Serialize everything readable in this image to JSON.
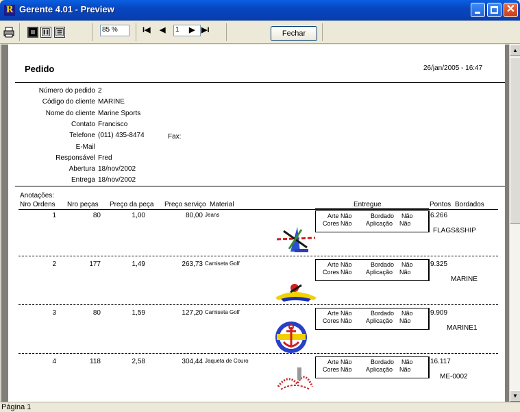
{
  "window": {
    "title": "Gerente 4.01 - Preview",
    "app_icon_letter": "R"
  },
  "toolbar": {
    "zoom": "85 %",
    "page_input": "1",
    "close_label": "Fechar",
    "nav_first": "I◀",
    "nav_prev": "◀",
    "nav_next": "▶",
    "nav_last": "▶I"
  },
  "report": {
    "title": "Pedido",
    "date": "26/jan/2005 - 16:47",
    "fields": [
      {
        "label": "Número do pedido",
        "value": "2"
      },
      {
        "label": "Código do cliente",
        "value": "MARINE"
      },
      {
        "label": "Nome do cliente",
        "value": "Marine Sports"
      },
      {
        "label": "Contato",
        "value": "Francisco"
      },
      {
        "label": "Telefone",
        "value": "(011) 435-8474"
      },
      {
        "label": "E-Mail",
        "value": ""
      },
      {
        "label": "Responsável",
        "value": "Fred"
      },
      {
        "label": "Abertura",
        "value": "18/nov/2002"
      },
      {
        "label": "Entrega",
        "value": "18/nov/2002"
      }
    ],
    "fax_label": "Fax:",
    "annotations_label": "Anotações:",
    "columns": {
      "nro": "Nro Ordens",
      "pecas": "Nro peças",
      "preco_peca": "Preço da peça",
      "preco_servico": "Preço serviço",
      "material": "Material",
      "entregue": "Entregue",
      "pontos": "Pontos",
      "bordados": "Bordados"
    },
    "entregue_labels": {
      "arte": "Arte",
      "cores": "Cores",
      "bordado": "Bordado",
      "aplicacao": "Aplicação",
      "nao": "Não"
    },
    "rows": [
      {
        "nro": "1",
        "pecas": "80",
        "preco_peca": "1,00",
        "preco_servico": "80,00",
        "material": "Jeans",
        "pontos": "6.266",
        "bordado": "FLAGS&SHIP",
        "logo": "flags-ship-logo"
      },
      {
        "nro": "2",
        "pecas": "177",
        "preco_peca": "1,49",
        "preco_servico": "263,73",
        "material": "Camiseta Golf",
        "pontos": "9.325",
        "bordado": "MARINE",
        "logo": "marine-logo"
      },
      {
        "nro": "3",
        "pecas": "80",
        "preco_peca": "1,59",
        "preco_servico": "127,20",
        "material": "Camiseta Golf",
        "pontos": "9.909",
        "bordado": "MARINE1",
        "logo": "anchor-logo"
      },
      {
        "nro": "4",
        "pecas": "118",
        "preco_peca": "2,58",
        "preco_servico": "304,44",
        "material": "Jaqueta de Couro",
        "pontos": "16.117",
        "bordado": "ME-0002",
        "logo": "me-0002-logo"
      }
    ]
  },
  "status": {
    "page": "Página 1"
  },
  "colors": {
    "titlebar": "#0846c0",
    "paper": "#ffffff",
    "viewport_bg": "#807e77"
  }
}
